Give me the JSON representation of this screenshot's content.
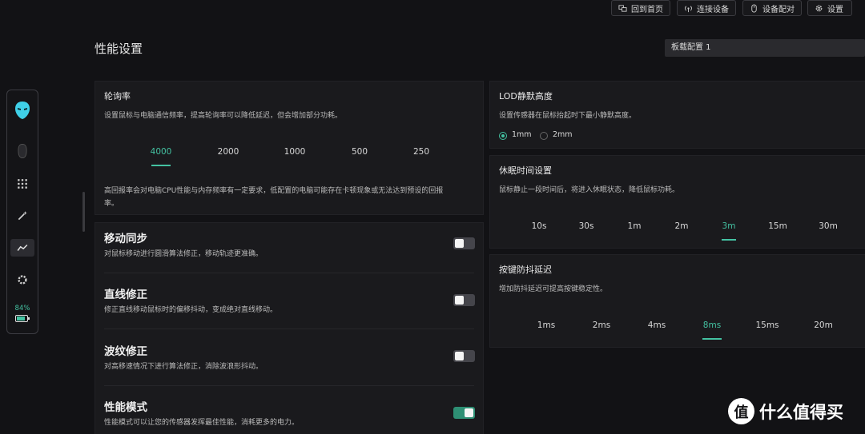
{
  "header": {
    "buttons": [
      {
        "label": "回到首页",
        "icon": "home-icon"
      },
      {
        "label": "连接设备",
        "icon": "wireless-icon"
      },
      {
        "label": "设备配对",
        "icon": "mouse-icon"
      },
      {
        "label": "设置",
        "icon": "gear-icon"
      }
    ],
    "page_title": "性能设置",
    "profile_selected": "板载配置 1"
  },
  "sidebar": {
    "items": [
      "alien-logo-icon",
      "mouse-device-icon",
      "keypad-grid-icon",
      "magic-wand-icon",
      "performance-graph-icon",
      "gear-icon"
    ],
    "active_item": "performance-graph-icon",
    "battery_percent": "84%",
    "accent": "#44c2a2"
  },
  "polling": {
    "title": "轮询率",
    "desc": "设置鼠标与电脑通信频率，提高轮询率可以降低延迟，但会增加部分功耗。",
    "options": [
      "4000",
      "2000",
      "1000",
      "500",
      "250"
    ],
    "selected": "4000",
    "note": "高回报率会对电脑CPU性能与内存频率有一定要求，低配置的电脑可能存在卡顿现象或无法达到预设的回报",
    "note2": "率。"
  },
  "toggles": [
    {
      "title": "移动同步",
      "desc": "对鼠标移动进行圆滑算法修正，移动轨迹更准确。",
      "on": false
    },
    {
      "title": "直线修正",
      "desc": "修正直线移动鼠标时的偏移抖动，变成绝对直线移动。",
      "on": false
    },
    {
      "title": "波纹修正",
      "desc": "对高移速情况下进行算法修正，消除波浪形抖动。",
      "on": false
    },
    {
      "title": "性能模式",
      "desc": "性能模式可以让您的传感器发挥最佳性能，消耗更多的电力。",
      "on": true
    }
  ],
  "lod": {
    "title": "LOD静默高度",
    "desc": "设置传感器在鼠标抬起时下最小静默高度。",
    "options": [
      "1mm",
      "2mm"
    ],
    "selected": "1mm"
  },
  "sleep": {
    "title": "休眠时间设置",
    "desc": "鼠标静止一段时间后，将进入休眠状态，降低鼠标功耗。",
    "options": [
      "10s",
      "30s",
      "1m",
      "2m",
      "3m",
      "15m",
      "30m"
    ],
    "selected": "3m"
  },
  "debounce": {
    "title": "按键防抖延迟",
    "desc": "增加防抖延迟可提高按键稳定性。",
    "options": [
      "1ms",
      "2ms",
      "4ms",
      "8ms",
      "15ms",
      "20m"
    ],
    "selected": "8ms"
  },
  "watermark": {
    "logo": "值",
    "text": "什么值得买"
  }
}
